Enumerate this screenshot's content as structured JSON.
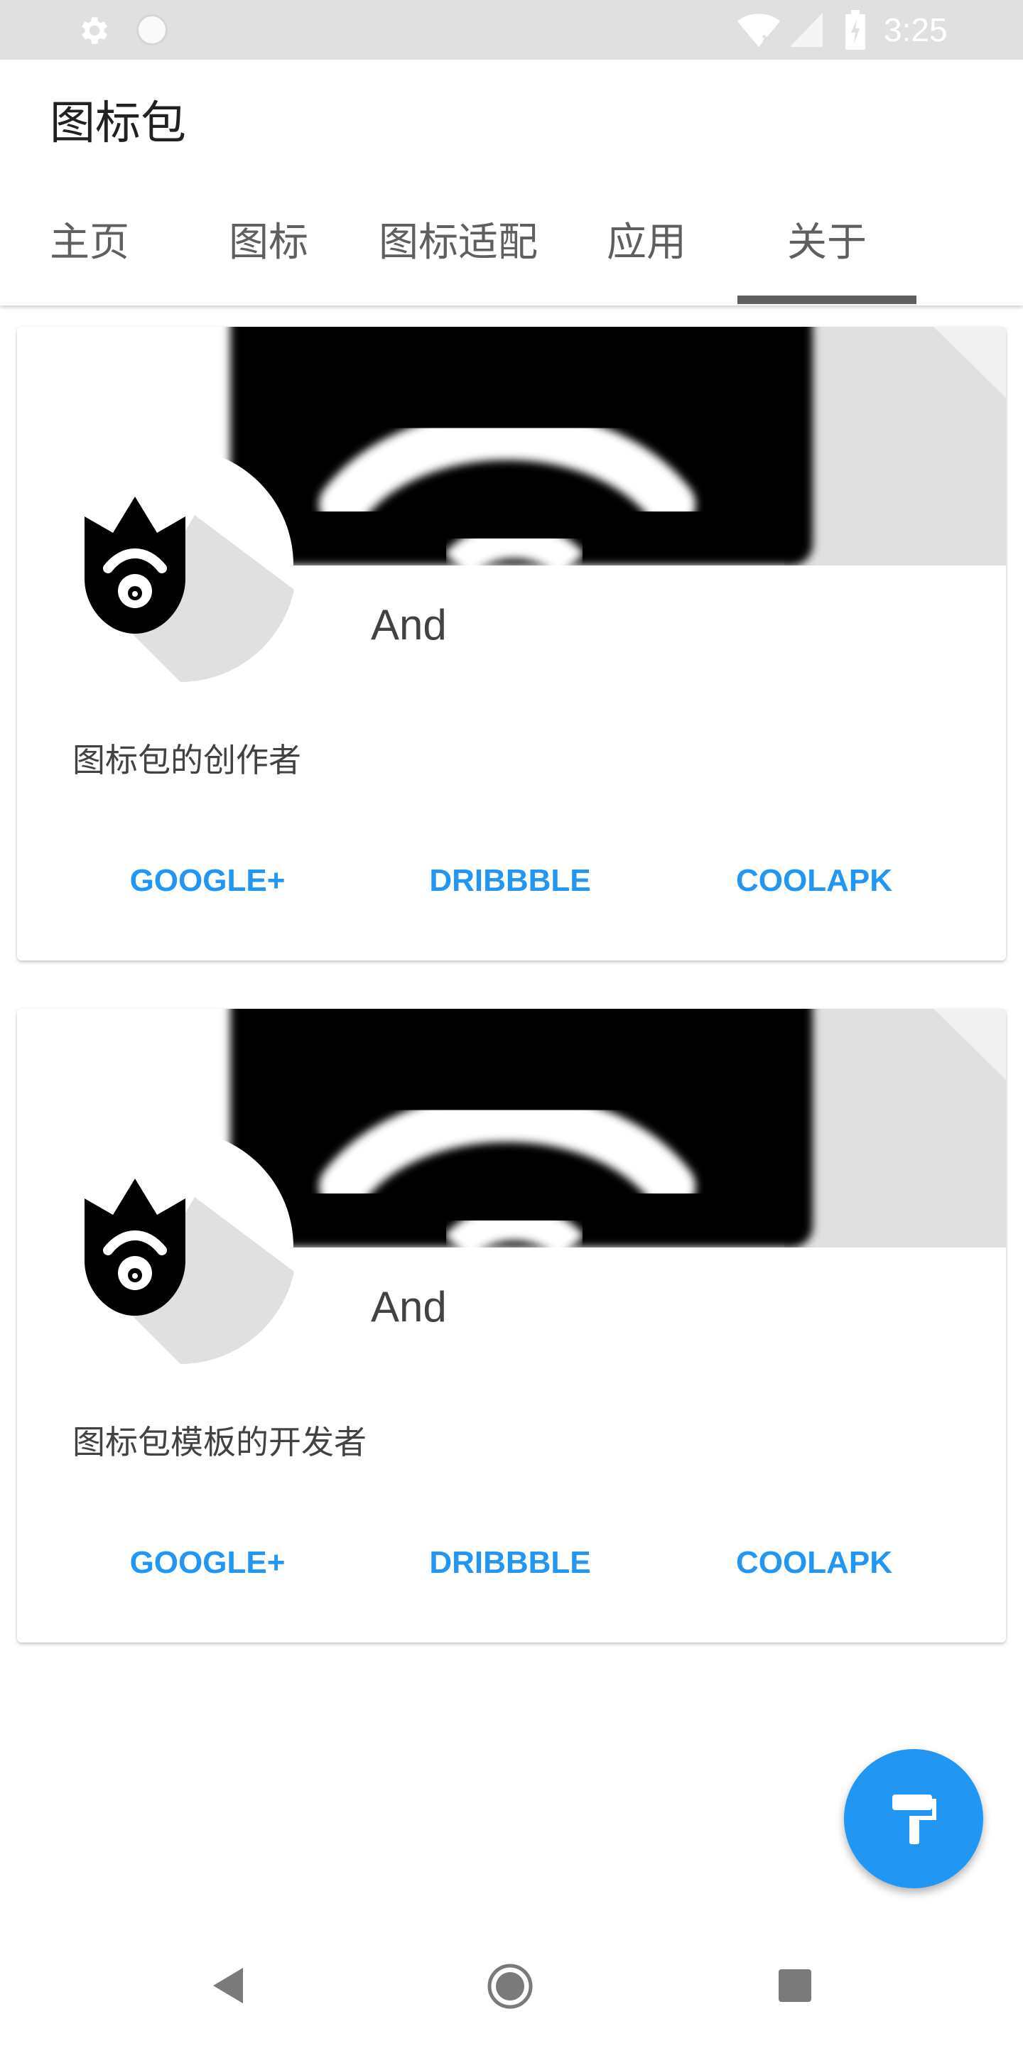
{
  "status_bar": {
    "time": "3:25",
    "icons": [
      "settings-icon",
      "sync-icon",
      "wifi-icon",
      "signal-icon",
      "battery-icon"
    ]
  },
  "app_bar": {
    "title": "图标包"
  },
  "tabs": [
    {
      "label": "主页",
      "selected": false
    },
    {
      "label": "图标",
      "selected": false
    },
    {
      "label": "图标适配",
      "selected": false
    },
    {
      "label": "应用",
      "selected": false
    },
    {
      "label": "关于",
      "selected": true
    }
  ],
  "cards": [
    {
      "name": "And",
      "description": "图标包的创作者",
      "buttons": [
        "GOOGLE+",
        "DRIBBBLE",
        "COOLAPK"
      ]
    },
    {
      "name": "And",
      "description": "图标包模板的开发者",
      "buttons": [
        "GOOGLE+",
        "DRIBBBLE",
        "COOLAPK"
      ]
    }
  ],
  "fab": {
    "icon": "paint-roller-icon"
  },
  "nav_bar": {
    "icons": [
      "back-icon",
      "home-icon",
      "recents-icon"
    ]
  },
  "colors": {
    "accent": "#2196f3",
    "status_bar": "#e0e0e0",
    "tab_text": "#5f5f5f"
  }
}
